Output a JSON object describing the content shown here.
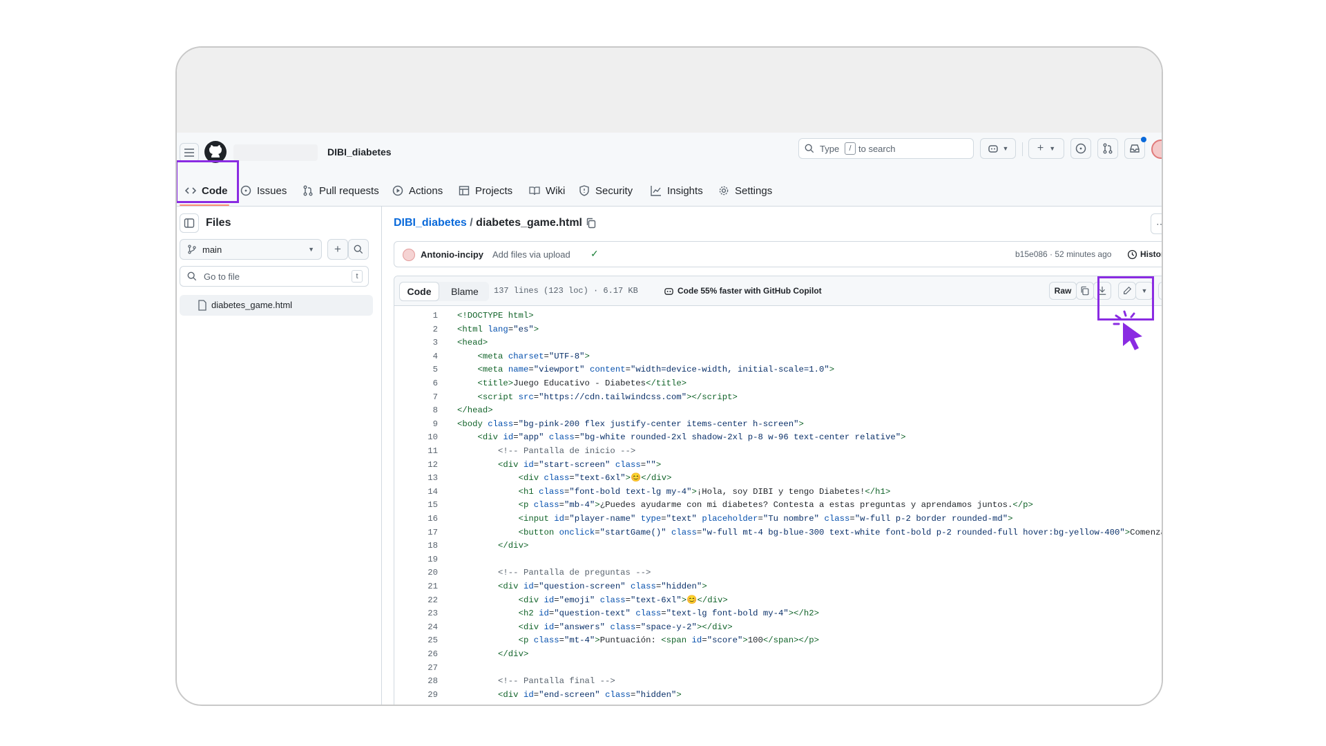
{
  "header": {
    "repo_name": "DIBI_diabetes",
    "search_placeholder": "Type / to search",
    "search_prefix": "Type",
    "search_key": "/",
    "search_suffix": "to search"
  },
  "tabs": [
    {
      "label": "Code",
      "icon": "code-icon"
    },
    {
      "label": "Issues",
      "icon": "issue-icon"
    },
    {
      "label": "Pull requests",
      "icon": "pull-request-icon"
    },
    {
      "label": "Actions",
      "icon": "play-icon"
    },
    {
      "label": "Projects",
      "icon": "table-icon"
    },
    {
      "label": "Wiki",
      "icon": "book-icon"
    },
    {
      "label": "Security",
      "icon": "shield-icon"
    },
    {
      "label": "Insights",
      "icon": "graph-icon"
    },
    {
      "label": "Settings",
      "icon": "gear-icon"
    }
  ],
  "sidebar": {
    "title": "Files",
    "branch": "main",
    "goto_placeholder": "Go to file",
    "goto_shortcut": "t",
    "files": [
      "diabetes_game.html"
    ]
  },
  "breadcrumb": {
    "repo": "DIBI_diabetes",
    "sep": "/",
    "file": "diabetes_game.html"
  },
  "commit": {
    "author": "Antonio-incipy",
    "message": "Add files via upload",
    "hash_time": "b15e086 · 52 minutes ago",
    "history": "History"
  },
  "file_toolbar": {
    "code_tab": "Code",
    "blame_tab": "Blame",
    "stats": "137 lines (123 loc) · 6.17 KB",
    "copilot": "Code 55% faster with GitHub Copilot",
    "raw": "Raw"
  },
  "colors": {
    "highlight": "#8a2be2",
    "link": "#0969da",
    "accent_underline": "#fd8c73"
  },
  "code_lines": [
    {
      "n": "1",
      "html": "<span class='tag'>&lt;!DOCTYPE html&gt;</span>"
    },
    {
      "n": "2",
      "html": "<span class='tag'>&lt;html</span> <span class='kw'>lang</span>=<span class='str'>\"es\"</span><span class='tag'>&gt;</span>"
    },
    {
      "n": "3",
      "html": "<span class='tag'>&lt;head&gt;</span>"
    },
    {
      "n": "4",
      "html": "    <span class='tag'>&lt;meta</span> <span class='kw'>charset</span>=<span class='str'>\"UTF-8\"</span><span class='tag'>&gt;</span>"
    },
    {
      "n": "5",
      "html": "    <span class='tag'>&lt;meta</span> <span class='kw'>name</span>=<span class='str'>\"viewport\"</span> <span class='kw'>content</span>=<span class='str'>\"width=device-width, initial-scale=1.0\"</span><span class='tag'>&gt;</span>"
    },
    {
      "n": "6",
      "html": "    <span class='tag'>&lt;title&gt;</span>Juego Educativo - Diabetes<span class='tag'>&lt;/title&gt;</span>"
    },
    {
      "n": "7",
      "html": "    <span class='tag'>&lt;script</span> <span class='kw'>src</span>=<span class='str'>\"https://cdn.tailwindcss.com\"</span><span class='tag'>&gt;&lt;/script&gt;</span>"
    },
    {
      "n": "8",
      "html": "<span class='tag'>&lt;/head&gt;</span>"
    },
    {
      "n": "9",
      "html": "<span class='tag'>&lt;body</span> <span class='kw'>class</span>=<span class='str'>\"bg-pink-200 flex justify-center items-center h-screen\"</span><span class='tag'>&gt;</span>"
    },
    {
      "n": "10",
      "html": "    <span class='tag'>&lt;div</span> <span class='kw'>id</span>=<span class='str'>\"app\"</span> <span class='kw'>class</span>=<span class='str'>\"bg-white rounded-2xl shadow-2xl p-8 w-96 text-center relative\"</span><span class='tag'>&gt;</span>"
    },
    {
      "n": "11",
      "html": "        <span class='com'>&lt;!-- Pantalla de inicio --&gt;</span>"
    },
    {
      "n": "12",
      "html": "        <span class='tag'>&lt;div</span> <span class='kw'>id</span>=<span class='str'>\"start-screen\"</span> <span class='kw'>class</span>=<span class='str'>\"\"</span><span class='tag'>&gt;</span>"
    },
    {
      "n": "13",
      "html": "            <span class='tag'>&lt;div</span> <span class='kw'>class</span>=<span class='str'>\"text-6xl\"</span><span class='tag'>&gt;</span>😊<span class='tag'>&lt;/div&gt;</span>"
    },
    {
      "n": "14",
      "html": "            <span class='tag'>&lt;h1</span> <span class='kw'>class</span>=<span class='str'>\"font-bold text-lg my-4\"</span><span class='tag'>&gt;</span>¡Hola, soy DIBI y tengo Diabetes!<span class='tag'>&lt;/h1&gt;</span>"
    },
    {
      "n": "15",
      "html": "            <span class='tag'>&lt;p</span> <span class='kw'>class</span>=<span class='str'>\"mb-4\"</span><span class='tag'>&gt;</span>¿Puedes ayudarme con mi diabetes? Contesta a estas preguntas y aprendamos juntos.<span class='tag'>&lt;/p&gt;</span>"
    },
    {
      "n": "16",
      "html": "            <span class='tag'>&lt;input</span> <span class='kw'>id</span>=<span class='str'>\"player-name\"</span> <span class='kw'>type</span>=<span class='str'>\"text\"</span> <span class='kw'>placeholder</span>=<span class='str'>\"Tu nombre\"</span> <span class='kw'>class</span>=<span class='str'>\"w-full p-2 border rounded-md\"</span><span class='tag'>&gt;</span>"
    },
    {
      "n": "17",
      "html": "            <span class='tag'>&lt;button</span> <span class='kw'>onclick</span>=<span class='str'>\"startGame()\"</span> <span class='kw'>class</span>=<span class='str'>\"w-full mt-4 bg-blue-300 text-white font-bold p-2 rounded-full hover:bg-yellow-400\"</span><span class='tag'>&gt;</span>Comenzar&lt;"
    },
    {
      "n": "18",
      "html": "        <span class='tag'>&lt;/div&gt;</span>"
    },
    {
      "n": "19",
      "html": ""
    },
    {
      "n": "20",
      "html": "        <span class='com'>&lt;!-- Pantalla de preguntas --&gt;</span>"
    },
    {
      "n": "21",
      "html": "        <span class='tag'>&lt;div</span> <span class='kw'>id</span>=<span class='str'>\"question-screen\"</span> <span class='kw'>class</span>=<span class='str'>\"hidden\"</span><span class='tag'>&gt;</span>"
    },
    {
      "n": "22",
      "html": "            <span class='tag'>&lt;div</span> <span class='kw'>id</span>=<span class='str'>\"emoji\"</span> <span class='kw'>class</span>=<span class='str'>\"text-6xl\"</span><span class='tag'>&gt;</span>😊<span class='tag'>&lt;/div&gt;</span>"
    },
    {
      "n": "23",
      "html": "            <span class='tag'>&lt;h2</span> <span class='kw'>id</span>=<span class='str'>\"question-text\"</span> <span class='kw'>class</span>=<span class='str'>\"text-lg font-bold my-4\"</span><span class='tag'>&gt;&lt;/h2&gt;</span>"
    },
    {
      "n": "24",
      "html": "            <span class='tag'>&lt;div</span> <span class='kw'>id</span>=<span class='str'>\"answers\"</span> <span class='kw'>class</span>=<span class='str'>\"space-y-2\"</span><span class='tag'>&gt;&lt;/div&gt;</span>"
    },
    {
      "n": "25",
      "html": "            <span class='tag'>&lt;p</span> <span class='kw'>class</span>=<span class='str'>\"mt-4\"</span><span class='tag'>&gt;</span>Puntuación: <span class='tag'>&lt;span</span> <span class='kw'>id</span>=<span class='str'>\"score\"</span><span class='tag'>&gt;</span>100<span class='tag'>&lt;/span&gt;&lt;/p&gt;</span>"
    },
    {
      "n": "26",
      "html": "        <span class='tag'>&lt;/div&gt;</span>"
    },
    {
      "n": "27",
      "html": ""
    },
    {
      "n": "28",
      "html": "        <span class='com'>&lt;!-- Pantalla final --&gt;</span>"
    },
    {
      "n": "29",
      "html": "        <span class='tag'>&lt;div</span> <span class='kw'>id</span>=<span class='str'>\"end-screen\"</span> <span class='kw'>class</span>=<span class='str'>\"hidden\"</span><span class='tag'>&gt;</span>"
    }
  ]
}
